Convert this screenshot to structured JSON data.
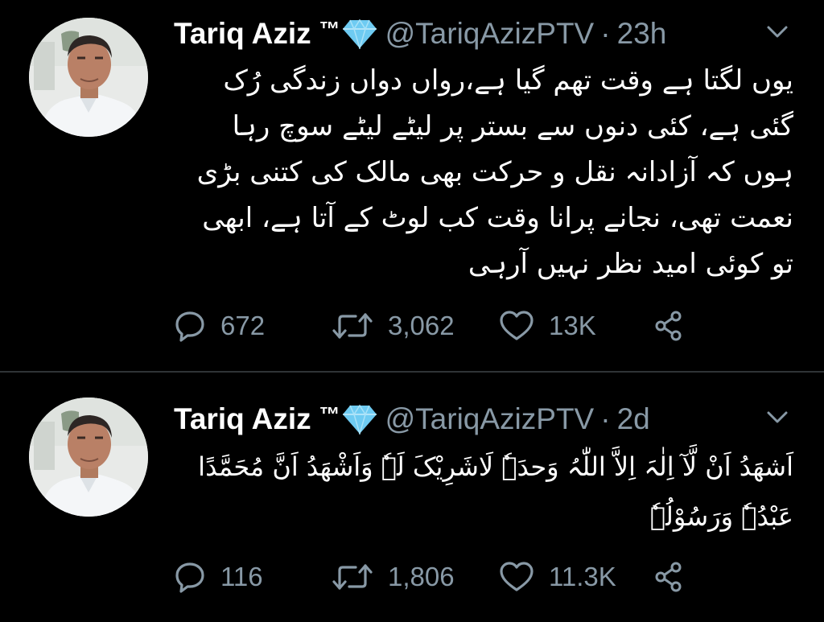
{
  "colors": {
    "background": "#000000",
    "text_primary": "#ffffff",
    "text_secondary": "#8899a6",
    "divider": "#2f3336",
    "verified_diamond": "#6ecbf2"
  },
  "tweets": [
    {
      "author": {
        "display_name": "Tariq Aziz",
        "trademark": "™",
        "emoji_icon": "diamond-icon",
        "handle": "@TariqAzizPTV",
        "separator": "·",
        "time": "23h"
      },
      "text": "یوں لگتا ہے وقت تھم گیا ہے،رواں دواں زندگی رُک گئی ہے، کئی دنوں سے بستر پر لیٹے لیٹے سوچ رہا ہوں کہ آزادانہ نقل و حرکت بھی مالک کی کتنی بڑی نعمت تھی، نجانے پرانا وقت کب لوٹ کے آتا ہے، ابھی تو کوئی امید نظر نہیں آرہی",
      "stats": {
        "replies": "672",
        "retweets": "3,062",
        "likes": "13K"
      }
    },
    {
      "author": {
        "display_name": "Tariq Aziz",
        "trademark": "™",
        "emoji_icon": "diamond-icon",
        "handle": "@TariqAzizPTV",
        "separator": "·",
        "time": "2d"
      },
      "text": "اَشھَدُ اَنْ لَّآ اِلٰہَ اِلاَّ اللّٰہُ وَحدَہٗ لَاشَرِیْکَ لَہٗ وَاَشْھَدُ اَنَّ مُحَمَّدًا عَبْدُہٗ وَرَسُوْلُہٗ",
      "stats": {
        "replies": "116",
        "retweets": "1,806",
        "likes": "11.3K"
      }
    }
  ]
}
